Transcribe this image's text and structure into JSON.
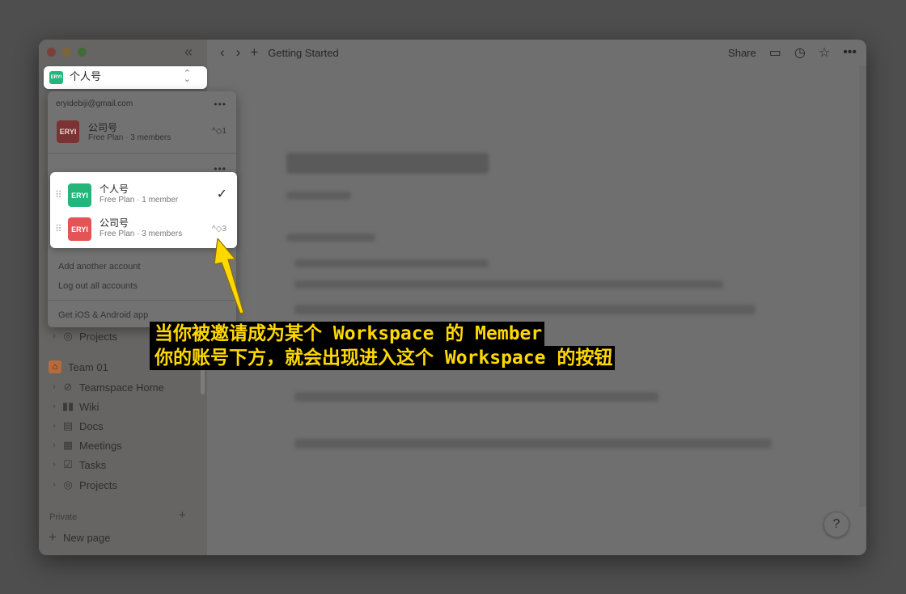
{
  "topbar": {
    "breadcrumb": "Getting Started",
    "share_label": "Share"
  },
  "workspace_switcher": {
    "logo_text": "ERYI",
    "name": "个人号"
  },
  "dropdown": {
    "email": "eryidebiji@gmail.com",
    "company_row": {
      "logo_text": "ERYI",
      "name": "公司号",
      "subtitle": "Free Plan · 3 members",
      "shortcut": "^◇1"
    },
    "links": {
      "add_account": "Add another account",
      "log_out": "Log out all accounts",
      "get_apps": "Get iOS & Android app"
    }
  },
  "accounts_card": {
    "items": [
      {
        "logo_text": "ERYI",
        "name": "个人号",
        "subtitle": "Free Plan · 1 member",
        "logo_color": "#23b57a"
      },
      {
        "logo_text": "ERYI",
        "name": "公司号",
        "subtitle": "Free Plan · 3 members",
        "shortcut": "^◇3",
        "logo_color": "#e45356"
      }
    ]
  },
  "sidebar": {
    "projects_top": "Projects",
    "team_name": "Team 01",
    "team_items": [
      {
        "label": "Teamspace Home",
        "icon": "compass-icon"
      },
      {
        "label": "Wiki",
        "icon": "book-icon"
      },
      {
        "label": "Docs",
        "icon": "doc-icon"
      },
      {
        "label": "Meetings",
        "icon": "calendar-icon"
      },
      {
        "label": "Tasks",
        "icon": "checkbox-icon"
      },
      {
        "label": "Projects",
        "icon": "target-icon"
      }
    ],
    "private_label": "Private",
    "new_page_label": "New page"
  },
  "help_label": "?",
  "annotation": {
    "line1": "当你被邀请成为某个 Workspace 的 Member",
    "line2": "你的账号下方，就会出现进入这个 Workspace 的按钮",
    "color": "#ffd800"
  }
}
